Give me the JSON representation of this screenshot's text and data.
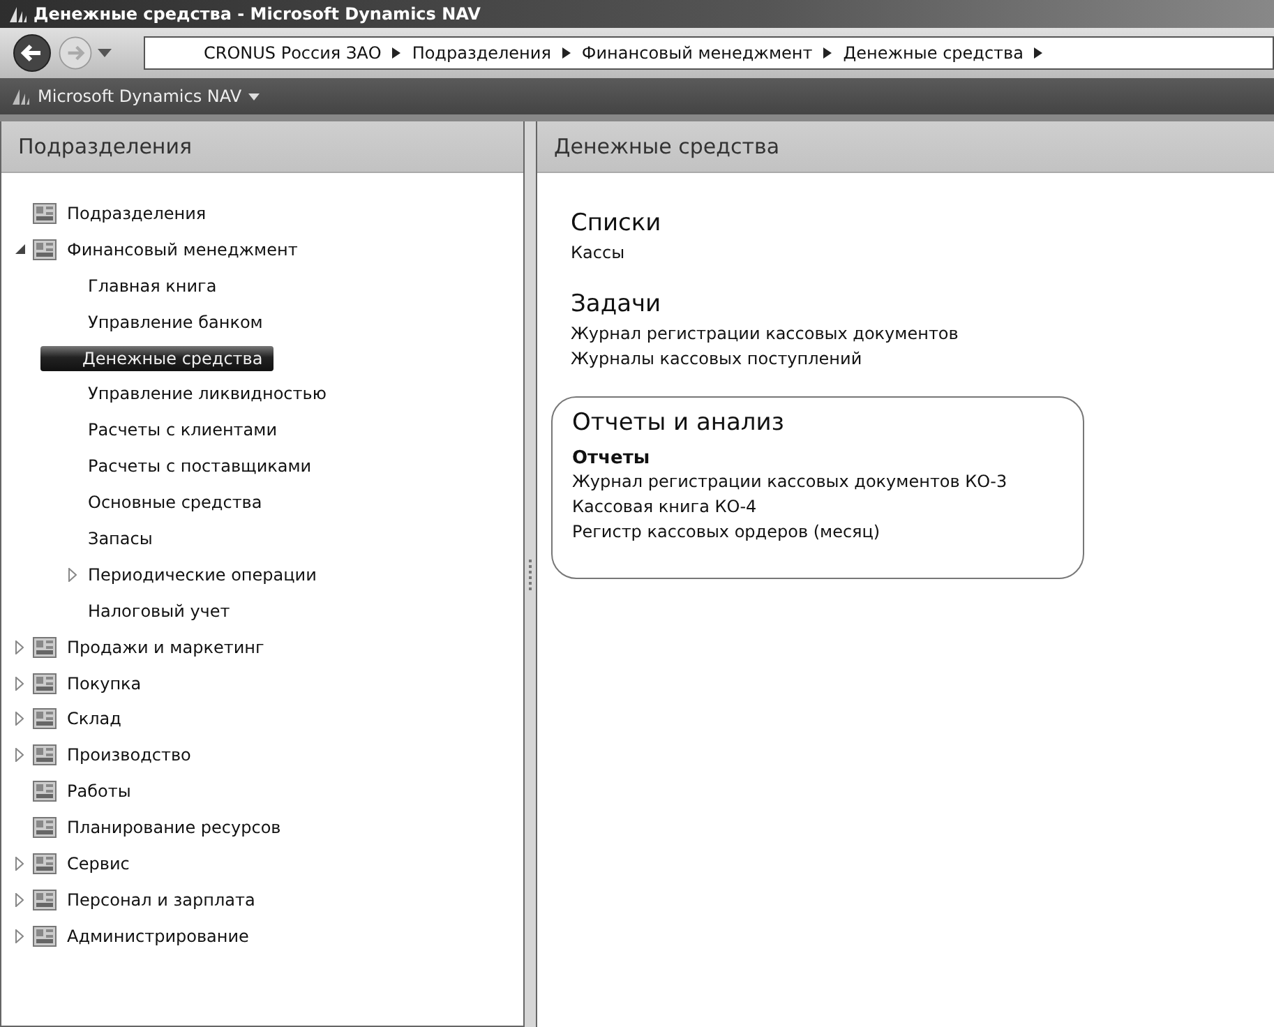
{
  "window": {
    "title": "Денежные средства - Microsoft Dynamics NAV"
  },
  "breadcrumb": [
    "CRONUS Россия ЗАО",
    "Подразделения",
    "Финансовый менеджмент",
    "Денежные средства"
  ],
  "app_menu": {
    "label": "Microsoft Dynamics NAV"
  },
  "navigation_pane": {
    "title": "Подразделения",
    "items": [
      {
        "label": "Подразделения",
        "selected": false
      },
      {
        "label": "Финансовый менеджмент",
        "selected": false,
        "expanded": true,
        "children": [
          {
            "label": "Главная книга",
            "selected": false
          },
          {
            "label": "Управление банком",
            "selected": false
          },
          {
            "label": "Денежные средства",
            "selected": true
          },
          {
            "label": "Управление ликвидностью",
            "selected": false
          },
          {
            "label": "Расчеты с клиентами",
            "selected": false
          },
          {
            "label": "Расчеты с поставщиками",
            "selected": false
          },
          {
            "label": "Основные средства",
            "selected": false
          },
          {
            "label": "Запасы",
            "selected": false
          },
          {
            "label": "Периодические операции",
            "selected": false,
            "expanded": false
          },
          {
            "label": "Налоговый учет",
            "selected": false
          }
        ]
      },
      {
        "label": "Продажи и маркетинг",
        "selected": false,
        "expanded": false
      },
      {
        "label": "Покупка",
        "selected": false,
        "expanded": false
      },
      {
        "label": "Склад",
        "selected": false,
        "expanded": false
      },
      {
        "label": "Производство",
        "selected": false,
        "expanded": false
      },
      {
        "label": "Работы",
        "selected": false
      },
      {
        "label": "Планирование ресурсов",
        "selected": false
      },
      {
        "label": "Сервис",
        "selected": false,
        "expanded": false
      },
      {
        "label": "Персонал и зарплата",
        "selected": false,
        "expanded": false
      },
      {
        "label": "Администрирование",
        "selected": false,
        "expanded": false
      }
    ]
  },
  "content_pane": {
    "title": "Денежные средства",
    "sections": [
      {
        "title": "Списки",
        "highlighted": false,
        "groups": [
          {
            "links": [
              "Кассы"
            ]
          }
        ]
      },
      {
        "title": "Задачи",
        "highlighted": false,
        "groups": [
          {
            "links": [
              "Журнал регистрации кассовых документов",
              "Журналы кассовых поступлений"
            ]
          }
        ]
      },
      {
        "title": "Отчеты и анализ",
        "highlighted": true,
        "groups": [
          {
            "heading": "Отчеты",
            "links": [
              "Журнал регистрации кассовых документов КО-3",
              "Кассовая книга КО-4",
              "Регистр кассовых ордеров (месяц)"
            ]
          }
        ]
      }
    ]
  }
}
